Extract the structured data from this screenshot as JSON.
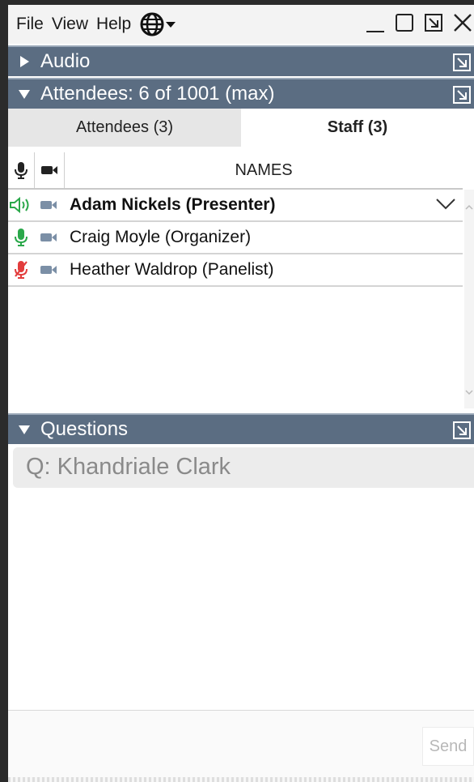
{
  "menu": {
    "file": "File",
    "view": "View",
    "help": "Help"
  },
  "sections": {
    "audio": "Audio",
    "attendees": "Attendees:  6 of 1001 (max)",
    "questions": "Questions"
  },
  "tabs": [
    {
      "label": "Attendees (3)",
      "active": false
    },
    {
      "label": "Staff (3)",
      "active": true
    }
  ],
  "table": {
    "names_header": "NAMES",
    "rows": [
      {
        "name": "Adam Nickels (Presenter)",
        "bold": true,
        "audio": "speaking"
      },
      {
        "name": "Craig Moyle (Organizer)",
        "bold": false,
        "audio": "unmuted"
      },
      {
        "name": "Heather Waldrop (Panelist)",
        "bold": false,
        "audio": "muted"
      }
    ]
  },
  "question": {
    "text": "Q: Khandriale Clark"
  },
  "compose": {
    "send_label": "Send"
  },
  "colors": {
    "section_header": "#5b6d82",
    "speaking": "#2aa84a",
    "muted": "#e23c3c",
    "camera": "#7b8fa6"
  }
}
